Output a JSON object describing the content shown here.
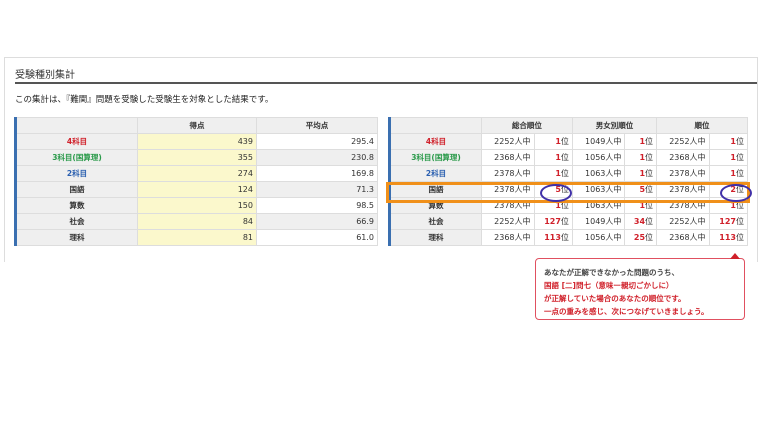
{
  "section_title": "受験種別集計",
  "description": "この集計は、『難関』問題を受験した受験生を対象とした結果です。",
  "left_table": {
    "headers": [
      "",
      "得点",
      "平均点"
    ],
    "rows": [
      {
        "label": "4科目",
        "color": "red",
        "score": "439",
        "avg": "295.4"
      },
      {
        "label": "3科目(国算理)",
        "color": "green",
        "score": "355",
        "avg": "230.8"
      },
      {
        "label": "2科目",
        "color": "blue",
        "score": "274",
        "avg": "169.8"
      },
      {
        "label": "国語",
        "color": "",
        "score": "124",
        "avg": "71.3"
      },
      {
        "label": "算数",
        "color": "",
        "score": "150",
        "avg": "98.5"
      },
      {
        "label": "社会",
        "color": "",
        "score": "84",
        "avg": "66.9"
      },
      {
        "label": "理科",
        "color": "",
        "score": "81",
        "avg": "61.0"
      }
    ]
  },
  "right_table": {
    "headers": [
      "",
      "総合順位",
      "男女別順位",
      "順位"
    ],
    "rank_suffix": "位",
    "rows": [
      {
        "label": "4科目",
        "color": "red",
        "c": [
          "2252人中",
          "1",
          "1049人中",
          "1",
          "2252人中",
          "1"
        ]
      },
      {
        "label": "3科目(国算理)",
        "color": "green",
        "c": [
          "2368人中",
          "1",
          "1056人中",
          "1",
          "2368人中",
          "1"
        ]
      },
      {
        "label": "2科目",
        "color": "blue",
        "c": [
          "2378人中",
          "1",
          "1063人中",
          "1",
          "2378人中",
          "1"
        ]
      },
      {
        "label": "国語",
        "color": "",
        "c": [
          "2378人中",
          "5",
          "1063人中",
          "5",
          "2378人中",
          "2"
        ]
      },
      {
        "label": "算数",
        "color": "",
        "c": [
          "2378人中",
          "1",
          "1063人中",
          "1",
          "2378人中",
          "1"
        ]
      },
      {
        "label": "社会",
        "color": "",
        "c": [
          "2252人中",
          "127",
          "1049人中",
          "34",
          "2252人中",
          "127"
        ]
      },
      {
        "label": "理科",
        "color": "",
        "c": [
          "2368人中",
          "113",
          "1056人中",
          "25",
          "2368人中",
          "113"
        ]
      }
    ]
  },
  "tooltip": {
    "line1": "あなたが正解できなかった問題のうち、",
    "line2": "国語 [二]問七（意味ー親切ごかしに）",
    "line3": "が正解していた場合のあなたの順位です。",
    "line4": "一点の重みを感じ、次につなげていきましょう。"
  },
  "colors": {
    "highlight": "#f0901a",
    "circle": "#4030a8",
    "red": "#d0202a",
    "green": "#2a9a4a",
    "blue": "#2a5fb0"
  }
}
